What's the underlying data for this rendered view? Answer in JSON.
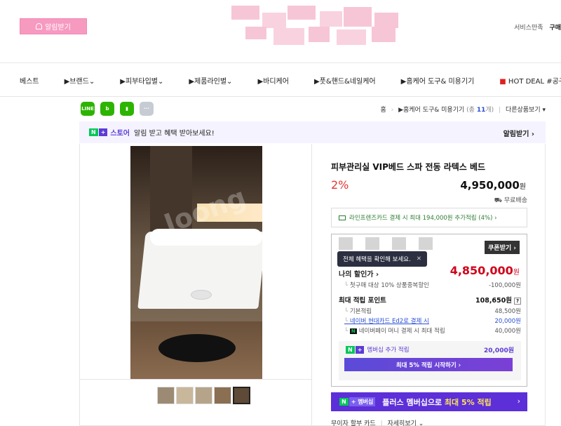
{
  "header": {
    "alarm_button": "알림받기",
    "util_links": [
      "서비스만족",
      "구매"
    ]
  },
  "nav": {
    "categories": [
      "베스트",
      "▶브랜드⌄",
      "▶피부타입별⌄",
      "▶제품라인별⌄",
      "▶바디케어",
      "▶풋&핸드&네일케어",
      "▶홈케어 도구& 미용기기",
      "HOT DEAL #공구"
    ]
  },
  "share": {
    "icons": [
      "line-icon",
      "band-icon",
      "bookmark-icon",
      "more-icon"
    ]
  },
  "breadcrumb": {
    "home": "홈",
    "current": "▶홈케어 도구& 미용기기",
    "count_prefix": "(총",
    "count": "11",
    "count_suffix": "개)",
    "other": "다른상품보기 ▾"
  },
  "store_banner": {
    "n": "N",
    "plus": "+",
    "label": "스토어",
    "message": "알림 받고 혜택 받아보세요!",
    "action": "알림받기 ›"
  },
  "product": {
    "title": "피부관리실 VIP베드 스파 전동 라텍스 베드",
    "discount": "2%",
    "price": "4,950,000",
    "won": "원",
    "shipping": "무료배송",
    "card_offer": "라인프렌즈카드 결제 시 최대 194,000원 추가적립 (4%) ›"
  },
  "benefit": {
    "coupon_button": "쿠폰받기 ›",
    "tooltip": "전체 혜택을 확인해 보세요.",
    "tooltip_close": "✕",
    "my_price_label": "나의 할인가 ›",
    "my_price": "4,850,000",
    "won": "원",
    "first_purchase": {
      "label": "첫구매 대상 10% 상품중복할인",
      "value": "-100,000원"
    },
    "max_points": {
      "label": "최대 적립 포인트",
      "value": "108,650원"
    },
    "basic_points": {
      "label": "기본적립",
      "value": "48,500원"
    },
    "card_points": {
      "label": "네이버 현대카드 Ed2로 결제 시",
      "value": "20,000원"
    },
    "npay_points": {
      "label": "네이버페이 머니 결제 시 최대 적립",
      "value": "40,000원"
    },
    "membership": {
      "label": "멤버십 추가 적립",
      "value": "20,000원"
    },
    "membership_button": "최대 5% 적립 시작하기 ›"
  },
  "plus_banner": {
    "badge_n": "N",
    "badge_plus": "+ 멤버십",
    "text_a": "플러스 멤버십으로 ",
    "text_b": "최대 5% 적립",
    "arrow": "›"
  },
  "bottom_links": [
    "무이자 할부 카드",
    "자세히보기 ⌄"
  ],
  "thumbnails_count": 6,
  "colors": {
    "accent_pink": "#f79ac0",
    "naver_green": "#03c75a",
    "plus_purple": "#5c3bd6",
    "discount_red": "#e23737"
  }
}
